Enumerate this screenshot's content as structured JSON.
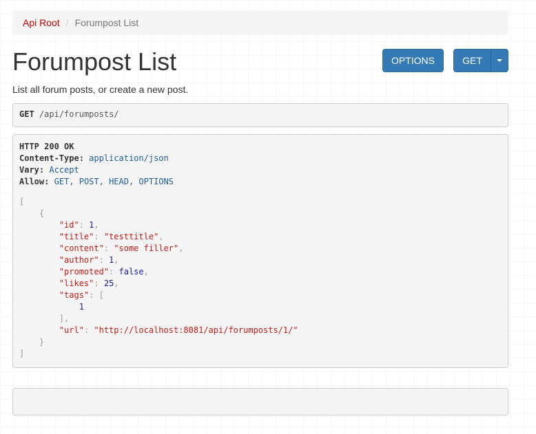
{
  "breadcrumb": {
    "root": "Api Root",
    "separator": "/",
    "current": "Forumpost List"
  },
  "page": {
    "title": "Forumpost List",
    "description": "List all forum posts, or create a new post."
  },
  "buttons": {
    "options_label": "OPTIONS",
    "get_label": "GET",
    "caret_icon": "caret-down-icon"
  },
  "request": {
    "method": "GET",
    "path": "/api/forumposts/"
  },
  "response": {
    "status_line": "HTTP 200 OK",
    "headers": [
      {
        "name": "Content-Type:",
        "value": "application/json"
      },
      {
        "name": "Vary:",
        "value": "Accept"
      },
      {
        "name": "Allow:",
        "value": "GET, POST, HEAD, OPTIONS"
      }
    ],
    "body": {
      "open_list": "[",
      "open_obj": "{",
      "fields": [
        {
          "key": "\"id\"",
          "value": "1",
          "kind": "num",
          "comma": ","
        },
        {
          "key": "\"title\"",
          "value": "\"testtitle\"",
          "kind": "str",
          "comma": ","
        },
        {
          "key": "\"content\"",
          "value": "\"some filler\"",
          "kind": "str",
          "comma": ","
        },
        {
          "key": "\"author\"",
          "value": "1",
          "kind": "num",
          "comma": ","
        },
        {
          "key": "\"promoted\"",
          "value": "false",
          "kind": "lit",
          "comma": ","
        },
        {
          "key": "\"likes\"",
          "value": "25",
          "kind": "num",
          "comma": ","
        }
      ],
      "tags_key": "\"tags\"",
      "tags_open": "[",
      "tags_values": [
        "1"
      ],
      "tags_close": "],",
      "url_key": "\"url\"",
      "url_value": "\"http://localhost:8081/api/forumposts/1/\"",
      "close_obj": "}",
      "close_list": "]"
    }
  },
  "colors": {
    "breadcrumb_link": "#c20000",
    "button_primary": "#337ab7",
    "json_key": "#c41a16",
    "json_number": "#1a1aa6",
    "header_value": "#1f5c99"
  }
}
